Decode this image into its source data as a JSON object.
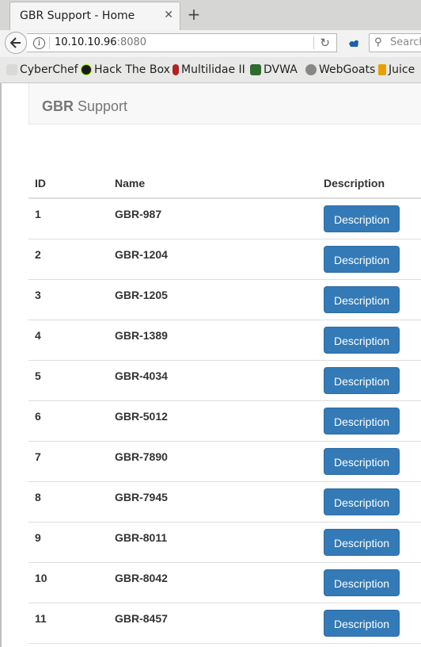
{
  "browser": {
    "tab_title": "GBR Support - Home",
    "tab_close": "✕",
    "new_tab": "+",
    "url_host": "10.10.10.96",
    "url_port": ":8080",
    "search_placeholder": "Search",
    "bookmarks": [
      {
        "label": "CyberChef",
        "icon": "chef-hat-icon",
        "color": "#cfcfcf"
      },
      {
        "label": "Hack The Box",
        "icon": "htb-cube-icon",
        "color": "#1a1a1a"
      },
      {
        "label": "Multilidae II",
        "icon": "bug-icon",
        "color": "#b22222"
      },
      {
        "label": "DVWA",
        "icon": "dvwa-icon",
        "color": "#2f6b2f"
      },
      {
        "label": "WebGoats",
        "icon": "globe-icon",
        "color": "#777777"
      },
      {
        "label": "Juice",
        "icon": "juice-icon",
        "color": "#e8a000"
      }
    ]
  },
  "site": {
    "brand_bold": "GBR",
    "brand_rest": " Support"
  },
  "table": {
    "headers": {
      "id": "ID",
      "name": "Name",
      "description": "Description"
    },
    "button_label": "Description",
    "rows": [
      {
        "id": "1",
        "name": "GBR-987"
      },
      {
        "id": "2",
        "name": "GBR-1204"
      },
      {
        "id": "3",
        "name": "GBR-1205"
      },
      {
        "id": "4",
        "name": "GBR-1389"
      },
      {
        "id": "5",
        "name": "GBR-4034"
      },
      {
        "id": "6",
        "name": "GBR-5012"
      },
      {
        "id": "7",
        "name": "GBR-7890"
      },
      {
        "id": "8",
        "name": "GBR-7945"
      },
      {
        "id": "9",
        "name": "GBR-8011"
      },
      {
        "id": "10",
        "name": "GBR-8042"
      },
      {
        "id": "11",
        "name": "GBR-8457"
      }
    ]
  },
  "colors": {
    "button_primary": "#337ab7",
    "header_bg": "#f8f8f8"
  }
}
